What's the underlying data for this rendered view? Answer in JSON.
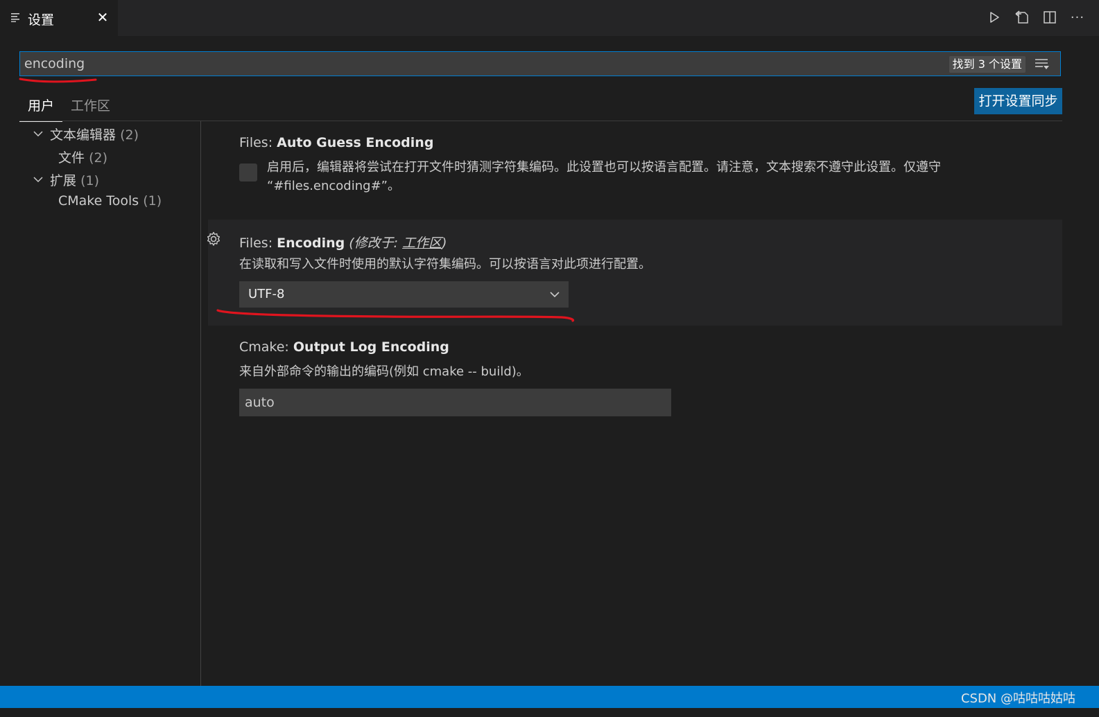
{
  "tab": {
    "label": "设置",
    "close_glyph": "✕"
  },
  "toolbar": {
    "actions": [
      "run-icon",
      "open-settings-json-icon",
      "split-editor-icon",
      "more-actions-icon"
    ],
    "more_glyph": "···"
  },
  "search": {
    "value": "encoding",
    "result_count": "找到 3 个设置"
  },
  "scope_tabs": [
    {
      "label": "用户",
      "active": true
    },
    {
      "label": "工作区",
      "active": false
    }
  ],
  "sync_button": "打开设置同步",
  "toc": [
    {
      "label": "文本编辑器",
      "count": "(2)",
      "level": 0,
      "expanded": true
    },
    {
      "label": "文件",
      "count": "(2)",
      "level": 1
    },
    {
      "label": "扩展",
      "count": "(1)",
      "level": 0,
      "expanded": true
    },
    {
      "label": "CMake Tools",
      "count": "(1)",
      "level": 1
    }
  ],
  "settings": [
    {
      "category": "Files:",
      "name": "Auto Guess Encoding",
      "desc_line1": "启用后，编辑器将尝试在打开文件时猜测字符集编码。此设置也可以按语言配置。请注意，文本搜索不遵守此设置。仅遵守",
      "desc_line2": "“#files.encoding#”。",
      "checked": false
    },
    {
      "category": "Files:",
      "name": "Encoding",
      "modified_prefix": "(修改于: ",
      "modified_link": "工作区",
      "modified_suffix": ")",
      "desc": "在读取和写入文件时使用的默认字符集编码。可以按语言对此项进行配置。",
      "value": "UTF-8"
    },
    {
      "category": "Cmake:",
      "name": "Output Log Encoding",
      "desc": "来自外部命令的输出的编码(例如 cmake -- build)。",
      "value": "auto"
    }
  ],
  "status": {
    "watermark": "CSDN @咕咕咕姑咕"
  },
  "colors": {
    "accent": "#007acc",
    "button": "#0e639c",
    "background": "#1e1e1e",
    "annotation": "#e0141e"
  }
}
